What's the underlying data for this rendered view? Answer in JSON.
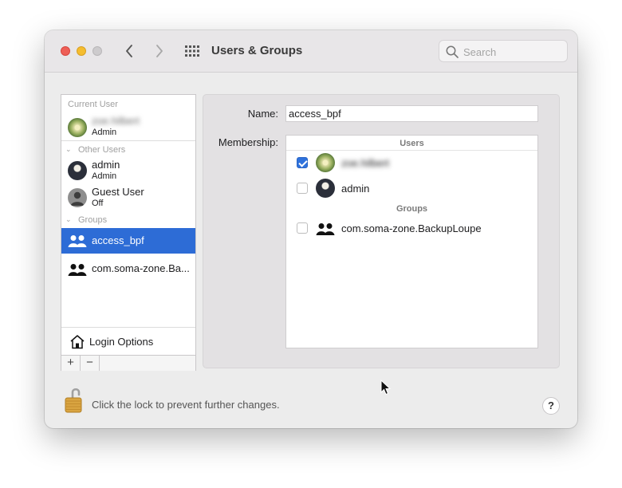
{
  "window": {
    "title": "Users & Groups",
    "search_placeholder": "Search"
  },
  "sidebar": {
    "current_user_header": "Current User",
    "current_user": {
      "name": "zoe.hilbert",
      "role": "Admin"
    },
    "other_users_header": "Other Users",
    "other_users": [
      {
        "name": "admin",
        "role": "Admin"
      },
      {
        "name": "Guest User",
        "role": "Off"
      }
    ],
    "groups_header": "Groups",
    "groups": [
      {
        "name": "access_bpf",
        "selected": true
      },
      {
        "name": "com.soma-zone.Ba..."
      }
    ],
    "login_options_label": "Login Options",
    "add_label": "+",
    "remove_label": "−"
  },
  "detail": {
    "name_label": "Name:",
    "name_value": "access_bpf",
    "membership_label": "Membership:",
    "users_header": "Users",
    "users": [
      {
        "name": "zoe.hilbert",
        "checked": true
      },
      {
        "name": "admin",
        "checked": false
      }
    ],
    "groups_header": "Groups",
    "groups": [
      {
        "name": "com.soma-zone.BackupLoupe",
        "checked": false
      }
    ]
  },
  "footer": {
    "lock_text": "Click the lock to prevent further changes.",
    "help_label": "?"
  },
  "colors": {
    "selection": "#2d6cd6",
    "checkbox_checked": "#2f72dc",
    "close": "#ee5f57",
    "minimize": "#f5bd2f"
  }
}
